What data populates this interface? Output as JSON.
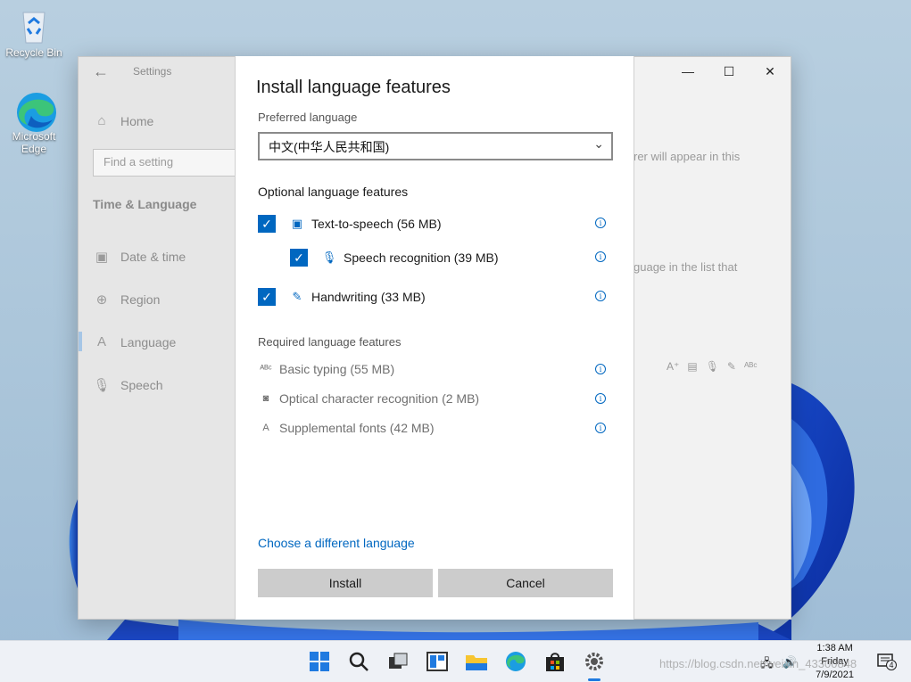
{
  "desktop": {
    "icons": [
      {
        "label": "Recycle Bin"
      },
      {
        "label": "Microsoft Edge"
      }
    ]
  },
  "settings": {
    "app_title": "Settings",
    "search_placeholder": "Find a setting",
    "section_title": "Time & Language",
    "nav": {
      "home": "Home",
      "date_time": "Date & time",
      "region": "Region",
      "language": "Language",
      "speech": "Speech"
    },
    "background_text_1": "rer will appear in this",
    "background_text_2": "guage in the list that"
  },
  "dialog": {
    "title": "Install language features",
    "preferred_label": "Preferred language",
    "preferred_value": "中文(中华人民共和国)",
    "optional_heading": "Optional language features",
    "optional": [
      {
        "label": "Text-to-speech (56 MB)",
        "checked": true
      },
      {
        "label": "Speech recognition (39 MB)",
        "checked": true
      },
      {
        "label": "Handwriting (33 MB)",
        "checked": true
      }
    ],
    "required_heading": "Required language features",
    "required": [
      {
        "label": "Basic typing (55 MB)"
      },
      {
        "label": "Optical character recognition (2 MB)"
      },
      {
        "label": "Supplemental fonts (42 MB)"
      }
    ],
    "change_link": "Choose a different language",
    "install_label": "Install",
    "cancel_label": "Cancel"
  },
  "taskbar": {
    "time": "1:38 AM",
    "day": "Friday",
    "date": "7/9/2021",
    "notification_count": "4",
    "watermark": "https://blog.csdn.net/weixin_43300848"
  },
  "colors": {
    "accent": "#0067c0",
    "button_bg": "#cccccc",
    "sidebar_bg": "#e6e6e6"
  }
}
